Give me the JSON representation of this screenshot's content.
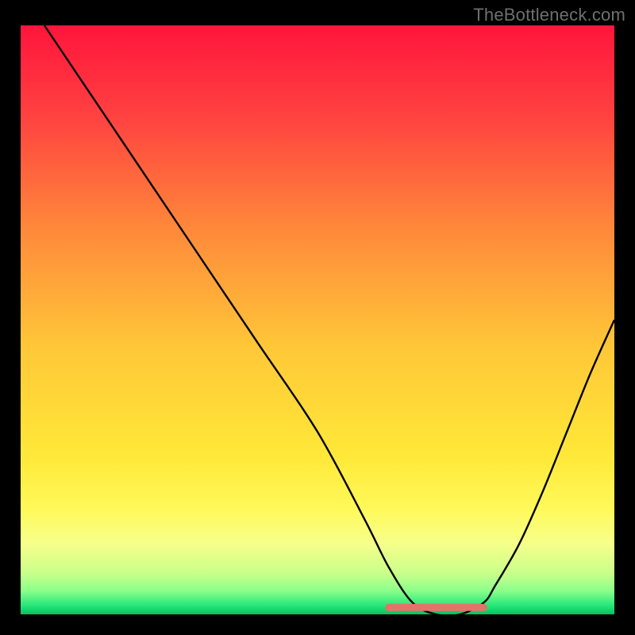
{
  "watermark": "TheBottleneck.com",
  "chart_data": {
    "type": "line",
    "title": "",
    "xlabel": "",
    "ylabel": "",
    "xlim": [
      0,
      100
    ],
    "ylim": [
      0,
      100
    ],
    "grid": false,
    "legend": false,
    "series": [
      {
        "name": "curve",
        "color": "#000000",
        "x": [
          4,
          10,
          20,
          30,
          40,
          50,
          58,
          62,
          66,
          70,
          74,
          78,
          80,
          84,
          88,
          92,
          96,
          100
        ],
        "y": [
          100,
          91,
          76,
          61,
          46,
          31,
          16,
          8,
          2,
          0,
          0,
          2,
          5,
          12,
          21,
          31,
          41,
          50
        ]
      },
      {
        "name": "optimal-band",
        "color": "#e77168",
        "x": [
          62,
          78
        ],
        "y": [
          0.5,
          0.5
        ]
      }
    ],
    "gradient_stops": [
      {
        "pct": 0,
        "color": "#ff153c"
      },
      {
        "pct": 15,
        "color": "#ff4040"
      },
      {
        "pct": 35,
        "color": "#ff8a3a"
      },
      {
        "pct": 55,
        "color": "#ffc838"
      },
      {
        "pct": 73,
        "color": "#ffe838"
      },
      {
        "pct": 82,
        "color": "#fff95a"
      },
      {
        "pct": 88,
        "color": "#f6ff8a"
      },
      {
        "pct": 93,
        "color": "#c9ff8a"
      },
      {
        "pct": 96,
        "color": "#8bff8a"
      },
      {
        "pct": 98.5,
        "color": "#26e77a"
      },
      {
        "pct": 100,
        "color": "#06c060"
      }
    ]
  }
}
